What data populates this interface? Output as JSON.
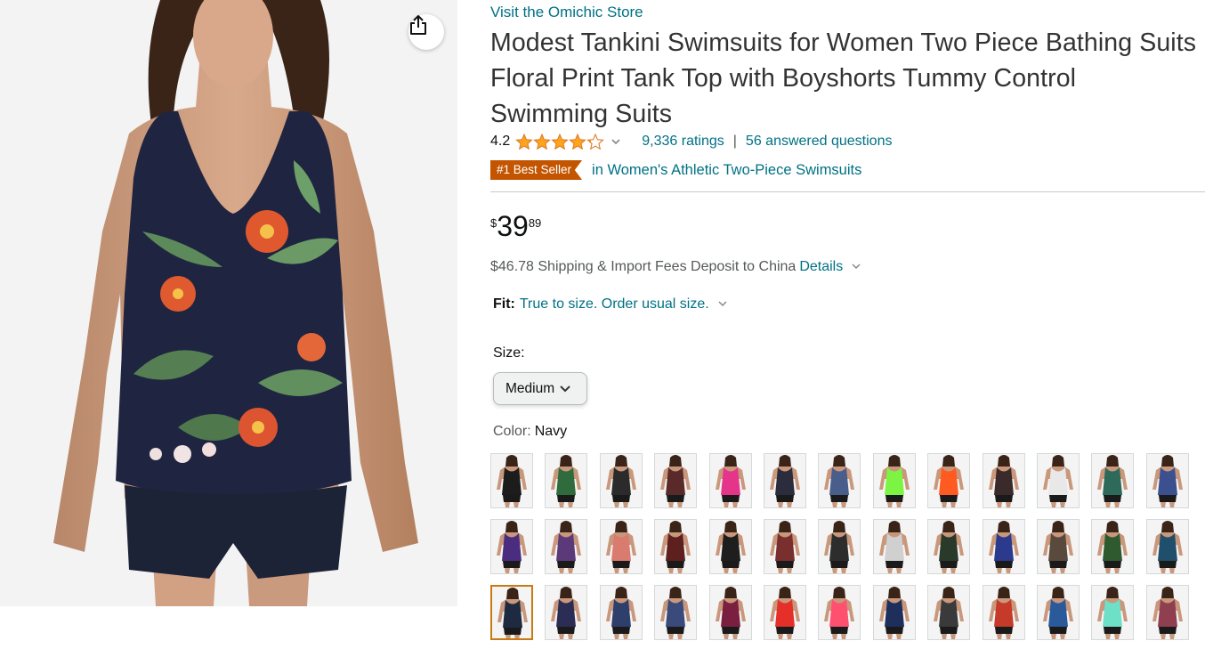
{
  "product": {
    "store_link": "Visit the Omichic Store",
    "title": "Modest Tankini Swimsuits for Women Two Piece Bathing Suits Floral Print Tank Top with Boyshorts Tummy Control Swimming Suits",
    "rating": "4.2",
    "rating_value": 4.2,
    "ratings_count": "9,336 ratings",
    "separator": "|",
    "answered_questions": "56 answered questions",
    "badge": "#1 Best Seller",
    "badge_category": "in Women's Athletic Two-Piece Swimsuits",
    "price": {
      "symbol": "$",
      "whole": "39",
      "fraction": "89"
    },
    "shipping_text": "$46.78 Shipping & Import Fees Deposit to China",
    "shipping_link": "Details",
    "fit_label": "Fit:",
    "fit_value": "True to size. Order usual size.",
    "size_label": "Size:",
    "size_value": "Medium",
    "color_label": "Color:",
    "color_value": "Navy"
  },
  "icons": {
    "share": "share-icon",
    "star": "star-icon",
    "chevron": "chevron-down-icon"
  },
  "colors": {
    "link": "#007185",
    "badge": "#c45500",
    "star": "#ffa41c",
    "selected_swatch_border": "#c77b12"
  },
  "swatch_colors": [
    [
      "#1c1c1c",
      "#2f6b3c",
      "#2b2b2b",
      "#5a2a2a",
      "#e4358b",
      "#2b2d3c",
      "#4a5e8c",
      "#7cf542",
      "#ff5a1f",
      "#3a2a2a",
      "#e8e8e8",
      "#2d6a5a",
      "#3c4f8f"
    ],
    [
      "#4b2d7f",
      "#5c3a7a",
      "#d97b6e",
      "#5e1f1f",
      "#1e1e1e",
      "#7a2f2f",
      "#2d2d2d",
      "#d0d0d0",
      "#2a3a2a",
      "#2b3a8c",
      "#5a4a3e",
      "#2f5a2f",
      "#1f4f6a"
    ],
    [
      "#1e2a40",
      "#2b2d55",
      "#2f3f6b",
      "#3a4a7a",
      "#7a1f3f",
      "#e5302a",
      "#ff5070",
      "#1e2f5c",
      "#3a3a3a",
      "#c63a2a",
      "#2a5a9a",
      "#6fe0c8",
      "#8f3f4f"
    ]
  ],
  "selected_swatch": [
    2,
    0
  ]
}
